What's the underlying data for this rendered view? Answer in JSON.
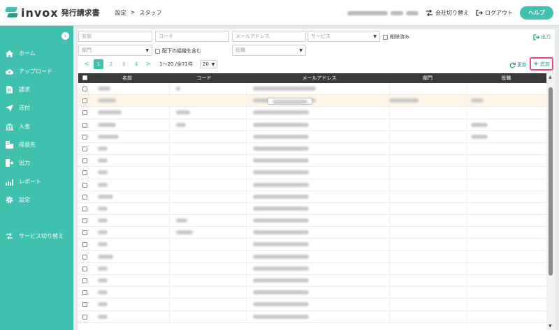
{
  "header": {
    "logo_text": "invox",
    "logo_sub": "発行請求書",
    "breadcrumb": [
      "設定",
      ">",
      "スタッフ"
    ],
    "switch_company": "会社切り替え",
    "logout": "ログアウト",
    "help": "ヘルプ"
  },
  "sidebar": {
    "items": [
      {
        "label": "ホーム",
        "icon": "home-icon"
      },
      {
        "label": "アップロード",
        "icon": "cloud-upload-icon"
      },
      {
        "label": "請求",
        "icon": "document-icon"
      },
      {
        "label": "送付",
        "icon": "send-icon"
      },
      {
        "label": "入金",
        "icon": "bank-icon"
      },
      {
        "label": "得意先",
        "icon": "building-icon"
      },
      {
        "label": "出力",
        "icon": "export-icon"
      },
      {
        "label": "レポート",
        "icon": "chart-icon"
      },
      {
        "label": "設定",
        "icon": "gear-icon"
      }
    ],
    "service_switch": "サービス切り替え"
  },
  "filters": {
    "name_placeholder": "名前",
    "code_placeholder": "コード",
    "email_placeholder": "メールアドレス",
    "service_placeholder": "サービス",
    "deleted_label": "削除済み",
    "department_placeholder": "部門",
    "include_sub_label": "配下の組織を含む",
    "position_placeholder": "役職",
    "export_label": "出力"
  },
  "pagination": {
    "prev": "<",
    "pages": [
      "1",
      "2",
      "3",
      "4"
    ],
    "next": ">",
    "summary": "1〜20 /全71件",
    "per_page": "20"
  },
  "actions": {
    "refresh": "更新",
    "add": "追加"
  },
  "table": {
    "headers": [
      "名前",
      "コード",
      "メールアドレス",
      "部門",
      "役職"
    ]
  },
  "colors": {
    "accent": "#40c1ad",
    "highlight_border": "#e8467c"
  }
}
